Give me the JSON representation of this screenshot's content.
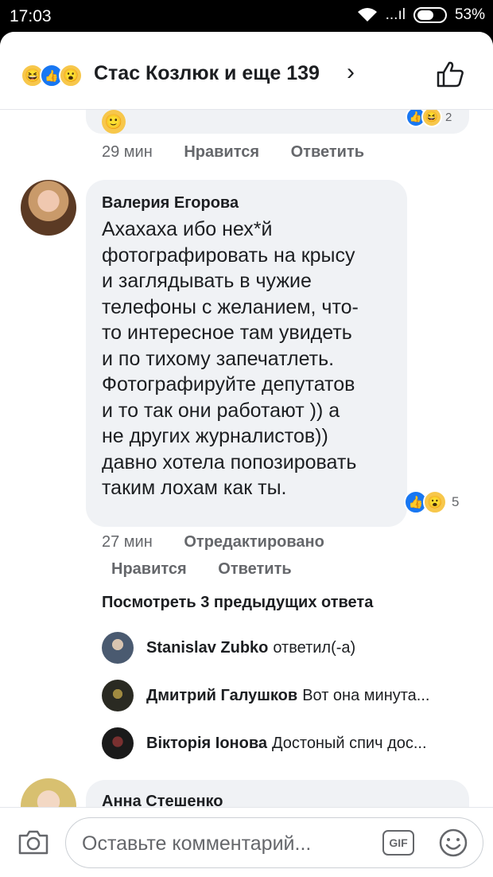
{
  "status_bar": {
    "time": "17:03",
    "signal": "...ıl",
    "battery": "53%"
  },
  "header": {
    "reactions": [
      {
        "icon": "haha-reaction-icon",
        "glyph": "😆"
      },
      {
        "icon": "like-reaction-icon",
        "glyph": "👍"
      },
      {
        "icon": "wow-reaction-icon",
        "glyph": "😮"
      }
    ],
    "title": "Стас Козлюк и еще 139",
    "chevron": "›",
    "like_icon": "like-outline-icon"
  },
  "previous_comment": {
    "emoji": "🙂",
    "reactions": [
      {
        "glyph": "👍"
      },
      {
        "glyph": "😆"
      }
    ],
    "reaction_count": "2",
    "time": "29 мин",
    "like_label": "Нравится",
    "reply_label": "Ответить"
  },
  "comment": {
    "author": "Валерия Егорова",
    "text": "Ахахаха  ибо нех*й\nфотографировать  на крысу\nи заглядывать в чужие\nтелефоны с желанием, что-\nто интересное там увидеть\nи по тихому запечатлеть.\nФотографируйте депутатов\nи то так они работают )) а\nне других журналистов))\nдавно хотела попозировать\nтаким лохам как ты.",
    "reactions": [
      {
        "glyph": "👍"
      },
      {
        "glyph": "😮"
      }
    ],
    "reaction_count": "5",
    "time": "27 мин",
    "edited_label": "Отредактировано",
    "like_label": "Нравится",
    "reply_label": "Ответить"
  },
  "replies": {
    "view_previous": "Посмотреть 3 предыдущих ответа",
    "items": [
      {
        "name": "Stanislav Zubko",
        "text": "ответил(-а)"
      },
      {
        "name": "Дмитрий Галушков",
        "text": "Вот она минута..."
      },
      {
        "name": "Вікторія Іонова",
        "text": "Достоный спич дос..."
      }
    ]
  },
  "next_comment": {
    "author": "Анна Стешенко"
  },
  "composer": {
    "placeholder": "Оставьте комментарий...",
    "gif_label": "GIF"
  },
  "colors": {
    "accent": "#1877f2",
    "bubble": "#f0f2f5",
    "meta_text": "#65676b"
  }
}
